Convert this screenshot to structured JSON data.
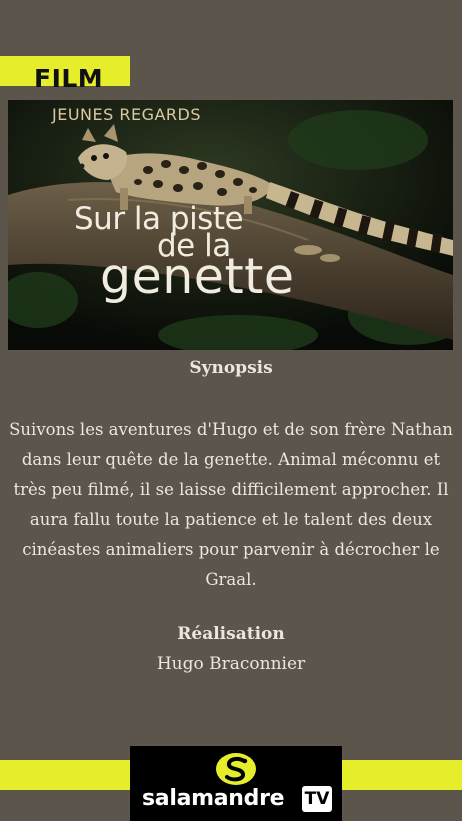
{
  "header": {
    "category": "FILM"
  },
  "poster": {
    "series": "JEUNES REGARDS",
    "title_line1": "Sur la piste",
    "title_line2": "de la",
    "title_line3": "genette"
  },
  "synopsis": {
    "heading": "Synopsis",
    "text": "Suivons les aventures d'Hugo et de son frère Nathan dans leur quête de la genette. Animal méconnu et très peu filmé, il se laisse difficilement approcher. Il aura fallu toute la patience et le talent des deux cinéastes animaliers pour parvenir à décrocher le Graal."
  },
  "realisation": {
    "heading": "Réalisation",
    "name": "Hugo Braconnier"
  },
  "logo": {
    "word": "salamandre",
    "badge": "TV",
    "icon": "salamander-s-icon"
  },
  "colors": {
    "background": "#5b554c",
    "accent": "#e6ee2c"
  }
}
